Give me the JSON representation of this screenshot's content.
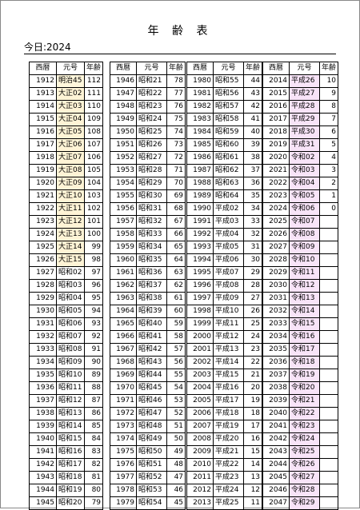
{
  "title": "年 齢 表",
  "today": {
    "label": "今日:",
    "year": "2024"
  },
  "headers": {
    "seireki": "西暦",
    "gengo": "元号",
    "nenrei": "年齢"
  },
  "columns": [
    {
      "rows": [
        {
          "y": "1912",
          "e": "明治45",
          "a": "112",
          "c": "c0"
        },
        {
          "y": "1913",
          "e": "大正02",
          "a": "111",
          "c": "c1"
        },
        {
          "y": "1914",
          "e": "大正03",
          "a": "110",
          "c": "c1"
        },
        {
          "y": "1915",
          "e": "大正04",
          "a": "109",
          "c": "c1"
        },
        {
          "y": "1916",
          "e": "大正05",
          "a": "108",
          "c": "c1"
        },
        {
          "y": "1917",
          "e": "大正06",
          "a": "107",
          "c": "c1"
        },
        {
          "y": "1918",
          "e": "大正07",
          "a": "106",
          "c": "c1"
        },
        {
          "y": "1919",
          "e": "大正08",
          "a": "105",
          "c": "c1"
        },
        {
          "y": "1920",
          "e": "大正09",
          "a": "104",
          "c": "c1"
        },
        {
          "y": "1921",
          "e": "大正10",
          "a": "103",
          "c": "c1"
        },
        {
          "y": "1922",
          "e": "大正11",
          "a": "102",
          "c": "c1"
        },
        {
          "y": "1923",
          "e": "大正12",
          "a": "101",
          "c": "c1"
        },
        {
          "y": "1924",
          "e": "大正13",
          "a": "100",
          "c": "c1"
        },
        {
          "y": "1925",
          "e": "大正14",
          "a": "99",
          "c": "c1"
        },
        {
          "y": "1926",
          "e": "大正15",
          "a": "98",
          "c": "c1"
        },
        {
          "y": "1927",
          "e": "昭和02",
          "a": "97",
          "c": "c2"
        },
        {
          "y": "1928",
          "e": "昭和03",
          "a": "96",
          "c": "c2"
        },
        {
          "y": "1929",
          "e": "昭和04",
          "a": "95",
          "c": "c2"
        },
        {
          "y": "1930",
          "e": "昭和05",
          "a": "94",
          "c": "c2"
        },
        {
          "y": "1931",
          "e": "昭和06",
          "a": "93",
          "c": "c2"
        },
        {
          "y": "1932",
          "e": "昭和07",
          "a": "92",
          "c": "c2"
        },
        {
          "y": "1933",
          "e": "昭和08",
          "a": "91",
          "c": "c2"
        },
        {
          "y": "1934",
          "e": "昭和09",
          "a": "90",
          "c": "c2"
        },
        {
          "y": "1935",
          "e": "昭和10",
          "a": "89",
          "c": "c2"
        },
        {
          "y": "1936",
          "e": "昭和11",
          "a": "88",
          "c": "c2"
        },
        {
          "y": "1937",
          "e": "昭和12",
          "a": "87",
          "c": "c2"
        },
        {
          "y": "1938",
          "e": "昭和13",
          "a": "86",
          "c": "c2"
        },
        {
          "y": "1939",
          "e": "昭和14",
          "a": "85",
          "c": "c2"
        },
        {
          "y": "1940",
          "e": "昭和15",
          "a": "84",
          "c": "c2"
        },
        {
          "y": "1941",
          "e": "昭和16",
          "a": "83",
          "c": "c2"
        },
        {
          "y": "1942",
          "e": "昭和17",
          "a": "82",
          "c": "c2"
        },
        {
          "y": "1943",
          "e": "昭和18",
          "a": "81",
          "c": "c2"
        },
        {
          "y": "1944",
          "e": "昭和19",
          "a": "80",
          "c": "c2"
        },
        {
          "y": "1945",
          "e": "昭和20",
          "a": "79",
          "c": "c2"
        }
      ]
    },
    {
      "rows": [
        {
          "y": "1946",
          "e": "昭和21",
          "a": "78",
          "c": "c2"
        },
        {
          "y": "1947",
          "e": "昭和22",
          "a": "77",
          "c": "c2"
        },
        {
          "y": "1948",
          "e": "昭和23",
          "a": "76",
          "c": "c2"
        },
        {
          "y": "1949",
          "e": "昭和24",
          "a": "75",
          "c": "c2"
        },
        {
          "y": "1950",
          "e": "昭和25",
          "a": "74",
          "c": "c2"
        },
        {
          "y": "1951",
          "e": "昭和26",
          "a": "73",
          "c": "c2"
        },
        {
          "y": "1952",
          "e": "昭和27",
          "a": "72",
          "c": "c2"
        },
        {
          "y": "1953",
          "e": "昭和28",
          "a": "71",
          "c": "c2"
        },
        {
          "y": "1954",
          "e": "昭和29",
          "a": "70",
          "c": "c2"
        },
        {
          "y": "1955",
          "e": "昭和30",
          "a": "69",
          "c": "c2"
        },
        {
          "y": "1956",
          "e": "昭和31",
          "a": "68",
          "c": "c2"
        },
        {
          "y": "1957",
          "e": "昭和32",
          "a": "67",
          "c": "c2"
        },
        {
          "y": "1958",
          "e": "昭和33",
          "a": "66",
          "c": "c2"
        },
        {
          "y": "1959",
          "e": "昭和34",
          "a": "65",
          "c": "c2"
        },
        {
          "y": "1960",
          "e": "昭和35",
          "a": "64",
          "c": "c2"
        },
        {
          "y": "1961",
          "e": "昭和36",
          "a": "63",
          "c": "c2"
        },
        {
          "y": "1962",
          "e": "昭和37",
          "a": "62",
          "c": "c2"
        },
        {
          "y": "1963",
          "e": "昭和38",
          "a": "61",
          "c": "c2"
        },
        {
          "y": "1964",
          "e": "昭和39",
          "a": "60",
          "c": "c2"
        },
        {
          "y": "1965",
          "e": "昭和40",
          "a": "59",
          "c": "c2"
        },
        {
          "y": "1966",
          "e": "昭和41",
          "a": "58",
          "c": "c2"
        },
        {
          "y": "1967",
          "e": "昭和42",
          "a": "57",
          "c": "c2"
        },
        {
          "y": "1968",
          "e": "昭和43",
          "a": "56",
          "c": "c2"
        },
        {
          "y": "1969",
          "e": "昭和44",
          "a": "55",
          "c": "c2"
        },
        {
          "y": "1970",
          "e": "昭和45",
          "a": "54",
          "c": "c2"
        },
        {
          "y": "1971",
          "e": "昭和46",
          "a": "53",
          "c": "c2"
        },
        {
          "y": "1972",
          "e": "昭和47",
          "a": "52",
          "c": "c2"
        },
        {
          "y": "1973",
          "e": "昭和48",
          "a": "51",
          "c": "c2"
        },
        {
          "y": "1974",
          "e": "昭和49",
          "a": "50",
          "c": "c2"
        },
        {
          "y": "1975",
          "e": "昭和50",
          "a": "49",
          "c": "c2"
        },
        {
          "y": "1976",
          "e": "昭和51",
          "a": "48",
          "c": "c2"
        },
        {
          "y": "1977",
          "e": "昭和52",
          "a": "47",
          "c": "c2"
        },
        {
          "y": "1978",
          "e": "昭和53",
          "a": "46",
          "c": "c2"
        },
        {
          "y": "1979",
          "e": "昭和54",
          "a": "45",
          "c": "c2"
        }
      ]
    },
    {
      "rows": [
        {
          "y": "1980",
          "e": "昭和55",
          "a": "44",
          "c": "c2"
        },
        {
          "y": "1981",
          "e": "昭和56",
          "a": "43",
          "c": "c2"
        },
        {
          "y": "1982",
          "e": "昭和57",
          "a": "42",
          "c": "c2"
        },
        {
          "y": "1983",
          "e": "昭和58",
          "a": "41",
          "c": "c2"
        },
        {
          "y": "1984",
          "e": "昭和59",
          "a": "40",
          "c": "c2"
        },
        {
          "y": "1985",
          "e": "昭和60",
          "a": "39",
          "c": "c2"
        },
        {
          "y": "1986",
          "e": "昭和61",
          "a": "38",
          "c": "c2"
        },
        {
          "y": "1987",
          "e": "昭和62",
          "a": "37",
          "c": "c2"
        },
        {
          "y": "1988",
          "e": "昭和63",
          "a": "36",
          "c": "c2"
        },
        {
          "y": "1989",
          "e": "昭和64",
          "a": "35",
          "c": "c2"
        },
        {
          "y": "1990",
          "e": "平成02",
          "a": "34",
          "c": "c3"
        },
        {
          "y": "1991",
          "e": "平成03",
          "a": "33",
          "c": "c3"
        },
        {
          "y": "1992",
          "e": "平成04",
          "a": "32",
          "c": "c3"
        },
        {
          "y": "1993",
          "e": "平成05",
          "a": "31",
          "c": "c3"
        },
        {
          "y": "1994",
          "e": "平成06",
          "a": "30",
          "c": "c3"
        },
        {
          "y": "1995",
          "e": "平成07",
          "a": "29",
          "c": "c3"
        },
        {
          "y": "1996",
          "e": "平成08",
          "a": "28",
          "c": "c3"
        },
        {
          "y": "1997",
          "e": "平成09",
          "a": "27",
          "c": "c3"
        },
        {
          "y": "1998",
          "e": "平成10",
          "a": "26",
          "c": "c3"
        },
        {
          "y": "1999",
          "e": "平成11",
          "a": "25",
          "c": "c3"
        },
        {
          "y": "2000",
          "e": "平成12",
          "a": "24",
          "c": "c3"
        },
        {
          "y": "2001",
          "e": "平成13",
          "a": "23",
          "c": "c3"
        },
        {
          "y": "2002",
          "e": "平成14",
          "a": "22",
          "c": "c3"
        },
        {
          "y": "2003",
          "e": "平成15",
          "a": "21",
          "c": "c3"
        },
        {
          "y": "2004",
          "e": "平成16",
          "a": "20",
          "c": "c3"
        },
        {
          "y": "2005",
          "e": "平成17",
          "a": "19",
          "c": "c3"
        },
        {
          "y": "2006",
          "e": "平成18",
          "a": "18",
          "c": "c3"
        },
        {
          "y": "2007",
          "e": "平成19",
          "a": "17",
          "c": "c3"
        },
        {
          "y": "2008",
          "e": "平成20",
          "a": "16",
          "c": "c3"
        },
        {
          "y": "2009",
          "e": "平成21",
          "a": "15",
          "c": "c3"
        },
        {
          "y": "2010",
          "e": "平成22",
          "a": "14",
          "c": "c3"
        },
        {
          "y": "2011",
          "e": "平成23",
          "a": "13",
          "c": "c3"
        },
        {
          "y": "2012",
          "e": "平成24",
          "a": "12",
          "c": "c3"
        },
        {
          "y": "2013",
          "e": "平成25",
          "a": "11",
          "c": "c3"
        }
      ]
    },
    {
      "rows": [
        {
          "y": "2014",
          "e": "平成26",
          "a": "10",
          "c": "c4"
        },
        {
          "y": "2015",
          "e": "平成27",
          "a": "9",
          "c": "c4"
        },
        {
          "y": "2016",
          "e": "平成28",
          "a": "8",
          "c": "c4"
        },
        {
          "y": "2017",
          "e": "平成29",
          "a": "7",
          "c": "c4"
        },
        {
          "y": "2018",
          "e": "平成30",
          "a": "6",
          "c": "c4"
        },
        {
          "y": "2019",
          "e": "平成31",
          "a": "5",
          "c": "c4"
        },
        {
          "y": "2020",
          "e": "令和02",
          "a": "4",
          "c": "c4"
        },
        {
          "y": "2021",
          "e": "令和03",
          "a": "3",
          "c": "c4"
        },
        {
          "y": "2022",
          "e": "令和04",
          "a": "2",
          "c": "c4"
        },
        {
          "y": "2023",
          "e": "令和05",
          "a": "1",
          "c": "c4"
        },
        {
          "y": "2024",
          "e": "令和06",
          "a": "0",
          "c": "c4"
        },
        {
          "y": "2025",
          "e": "令和07",
          "a": "",
          "c": "c4"
        },
        {
          "y": "2026",
          "e": "令和08",
          "a": "",
          "c": "c4"
        },
        {
          "y": "2027",
          "e": "令和09",
          "a": "",
          "c": "c4"
        },
        {
          "y": "2028",
          "e": "令和10",
          "a": "",
          "c": "c4"
        },
        {
          "y": "2029",
          "e": "令和11",
          "a": "",
          "c": "c4"
        },
        {
          "y": "2030",
          "e": "令和12",
          "a": "",
          "c": "c4"
        },
        {
          "y": "2031",
          "e": "令和13",
          "a": "",
          "c": "c4"
        },
        {
          "y": "2032",
          "e": "令和14",
          "a": "",
          "c": "c4"
        },
        {
          "y": "2033",
          "e": "令和15",
          "a": "",
          "c": "c4"
        },
        {
          "y": "2034",
          "e": "令和16",
          "a": "",
          "c": "c4"
        },
        {
          "y": "2035",
          "e": "令和17",
          "a": "",
          "c": "c4"
        },
        {
          "y": "2036",
          "e": "令和18",
          "a": "",
          "c": "c4"
        },
        {
          "y": "2037",
          "e": "令和19",
          "a": "",
          "c": "c4"
        },
        {
          "y": "2038",
          "e": "令和20",
          "a": "",
          "c": "c4"
        },
        {
          "y": "2039",
          "e": "令和21",
          "a": "",
          "c": "c4"
        },
        {
          "y": "2040",
          "e": "令和22",
          "a": "",
          "c": "c4"
        },
        {
          "y": "2041",
          "e": "令和23",
          "a": "",
          "c": "c4"
        },
        {
          "y": "2042",
          "e": "令和24",
          "a": "",
          "c": "c4"
        },
        {
          "y": "2043",
          "e": "令和25",
          "a": "",
          "c": "c4"
        },
        {
          "y": "2044",
          "e": "令和26",
          "a": "",
          "c": "c4"
        },
        {
          "y": "2045",
          "e": "令和27",
          "a": "",
          "c": "c4"
        },
        {
          "y": "2046",
          "e": "令和28",
          "a": "",
          "c": "c4"
        },
        {
          "y": "2047",
          "e": "令和29",
          "a": "",
          "c": "c4"
        }
      ]
    }
  ]
}
